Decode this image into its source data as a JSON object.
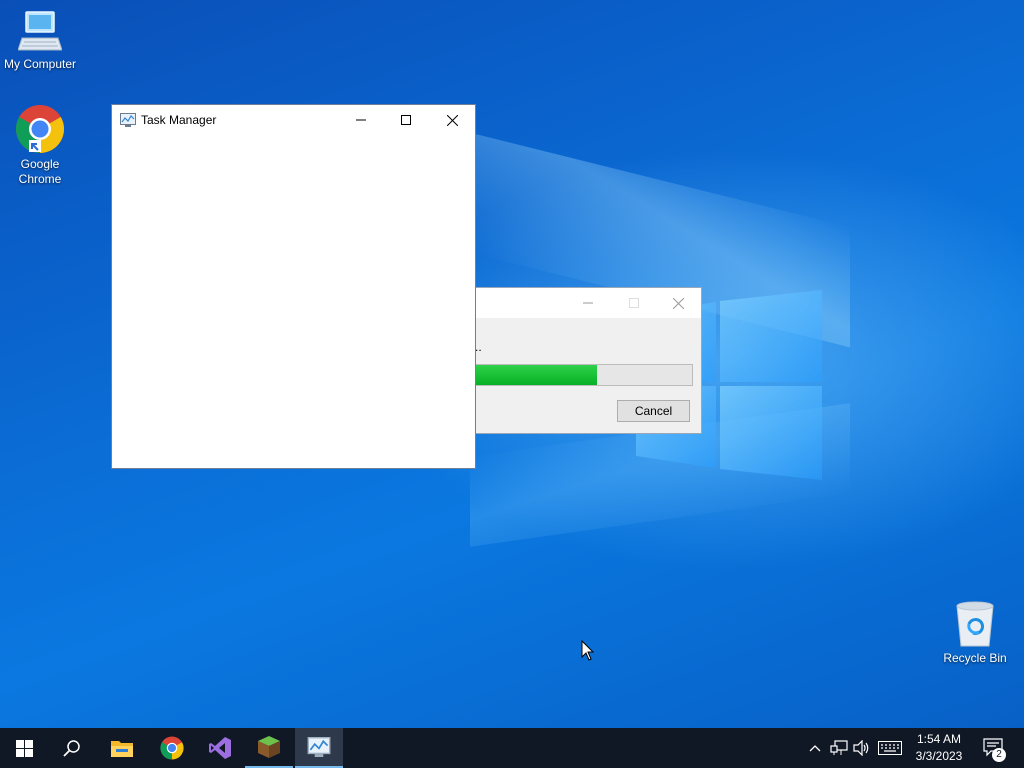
{
  "desktop": {
    "icons": [
      {
        "label": "My Computer",
        "icon": "monitor-icon"
      },
      {
        "label": "Google Chrome",
        "icon": "chrome-icon"
      },
      {
        "label": "Recycle Bin",
        "icon": "recycle-bin-icon"
      }
    ]
  },
  "task_manager": {
    "title": "Task Manager",
    "icon": "task-manager-icon"
  },
  "progress_dialog": {
    "message_fragment": "..",
    "progress_fraction": 0.56,
    "cancel_label": "Cancel"
  },
  "taskbar": {
    "pinned": [
      "start-icon",
      "search-icon",
      "file-explorer-icon",
      "chrome-icon",
      "visual-studio-icon",
      "minecraft-icon",
      "task-manager-icon"
    ],
    "clock_time": "1:54 AM",
    "clock_date": "3/3/2023",
    "notification_count": "2"
  },
  "colors": {
    "accent": "#76b9ed",
    "progress_green": "#06b025",
    "taskbar_bg": "#101826"
  }
}
